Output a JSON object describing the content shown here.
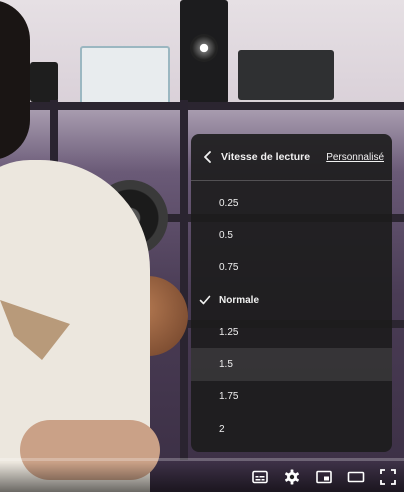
{
  "panel": {
    "title": "Vitesse de lecture",
    "custom_label": "Personnalisé",
    "options": [
      {
        "label": "0.25",
        "selected": false
      },
      {
        "label": "0.5",
        "selected": false
      },
      {
        "label": "0.75",
        "selected": false
      },
      {
        "label": "Normale",
        "selected": true
      },
      {
        "label": "1.25",
        "selected": false
      },
      {
        "label": "1.5",
        "selected": false
      },
      {
        "label": "1.75",
        "selected": false
      },
      {
        "label": "2",
        "selected": false
      }
    ],
    "hovered_index": 5
  },
  "controls": {
    "icons": [
      "subtitles-icon",
      "settings-gear-icon",
      "miniplayer-icon",
      "theater-mode-icon",
      "fullscreen-icon"
    ]
  },
  "progress": {
    "played_fraction": 0.0
  },
  "colors": {
    "panel_bg": "#1c1c1c",
    "text": "#f1f1f1",
    "progress": "#ff0000"
  }
}
